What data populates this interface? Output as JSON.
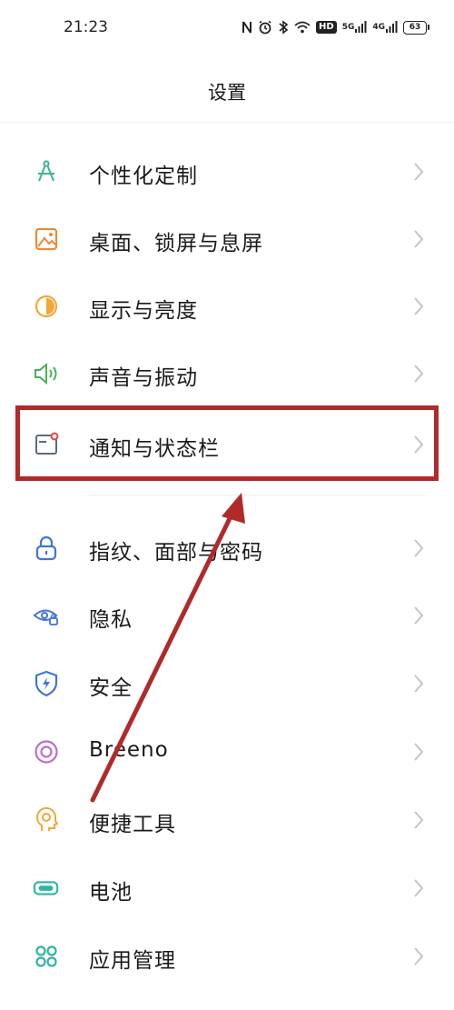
{
  "status_bar": {
    "time": "21:23",
    "hd": "HD",
    "net1": "5G",
    "net2": "4G",
    "battery": "63"
  },
  "header": {
    "title": "设置"
  },
  "items": [
    {
      "label": "个性化定制",
      "icon": "compass-icon",
      "color": "#3fb39a"
    },
    {
      "label": "桌面、锁屏与息屏",
      "icon": "wallpaper-icon",
      "color": "#e88b3c"
    },
    {
      "label": "显示与亮度",
      "icon": "brightness-icon",
      "color": "#f0a83a"
    },
    {
      "label": "声音与振动",
      "icon": "speaker-icon",
      "color": "#4cae5b"
    },
    {
      "label": "通知与状态栏",
      "icon": "notification-icon",
      "color": "#5a6a88"
    },
    {
      "label": "指纹、面部与密码",
      "icon": "lock-icon",
      "color": "#3f76d6"
    },
    {
      "label": "隐私",
      "icon": "privacy-eye-icon",
      "color": "#3f76d6"
    },
    {
      "label": "安全",
      "icon": "shield-icon",
      "color": "#3f76d6"
    },
    {
      "label": "Breeno",
      "icon": "breeno-icon",
      "color": "#b86fd0"
    },
    {
      "label": "便捷工具",
      "icon": "shortcut-tools-icon",
      "color": "#f0a83a"
    },
    {
      "label": "电池",
      "icon": "battery-icon",
      "color": "#2fb3a5"
    },
    {
      "label": "应用管理",
      "icon": "apps-grid-icon",
      "color": "#2fb3a5"
    }
  ],
  "annotation": {
    "box_color": "#b02a2a",
    "arrow_color": "#b02a2a"
  }
}
